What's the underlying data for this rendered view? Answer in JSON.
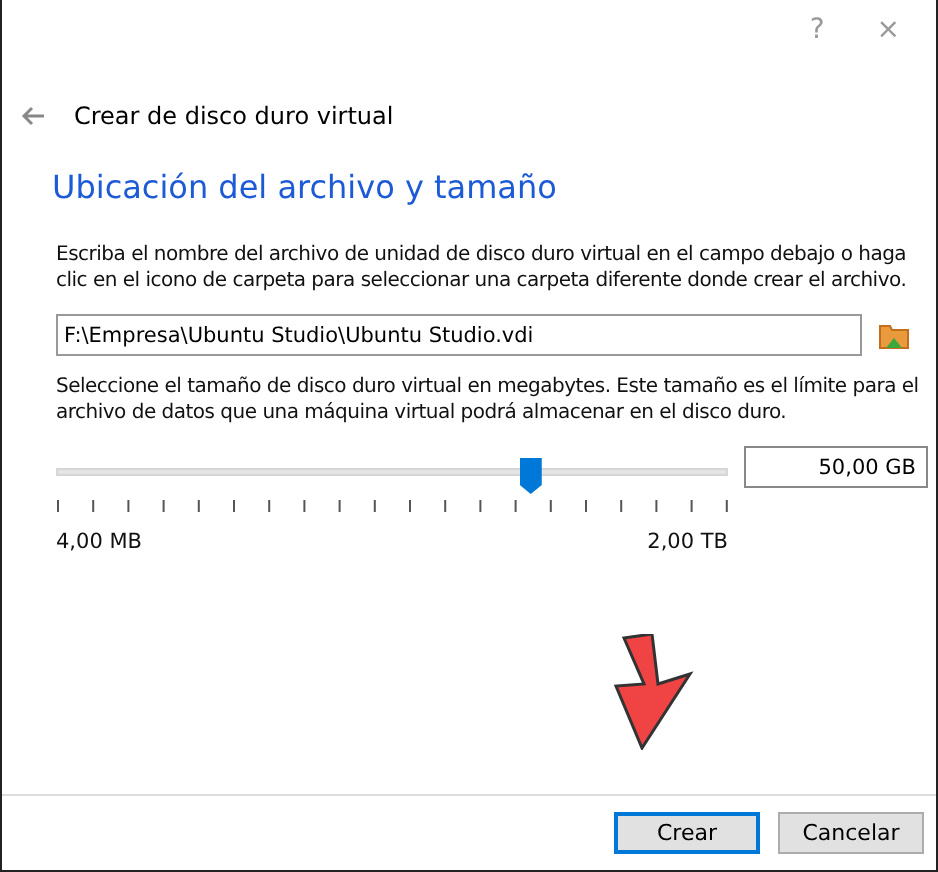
{
  "title_bar": {
    "help": "?",
    "close": "×"
  },
  "header": {
    "title": "Crear de disco duro virtual"
  },
  "heading": "Ubicación del archivo y tamaño",
  "location": {
    "description": "Escriba el nombre del archivo de unidad de disco duro virtual en el campo debajo o haga clic en el icono de carpeta para seleccionar una carpeta diferente donde crear el archivo.",
    "value": "F:\\Empresa\\Ubuntu Studio\\Ubuntu Studio.vdi"
  },
  "size": {
    "description": "Seleccione el tamaño de disco duro virtual en megabytes. Este tamaño es el límite para el archivo de datos que una máquina virtual podrá almacenar en el disco duro.",
    "level": 0.705,
    "value": "50,00 GB",
    "min_label": "4,00 MB",
    "max_label": "2,00 TB"
  },
  "buttons": [
    {
      "label": "Crear",
      "selected": true
    },
    {
      "label": "Cancelar",
      "selected": false
    }
  ]
}
